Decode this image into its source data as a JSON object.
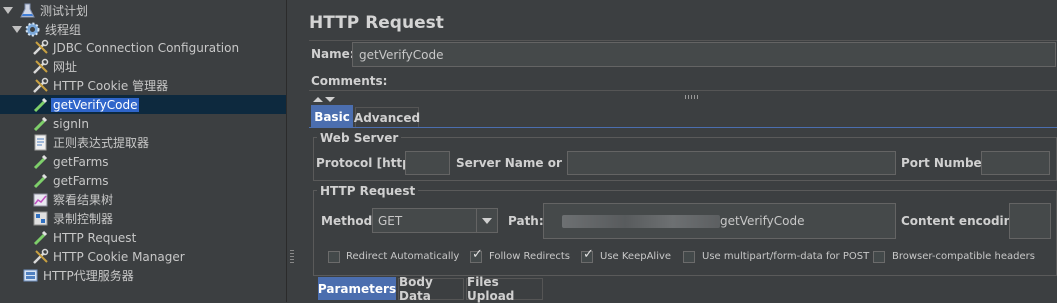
{
  "tree": {
    "items": [
      {
        "label": "测试计划",
        "icon": "flask-icon"
      },
      {
        "label": "线程组",
        "icon": "gear-icon"
      },
      {
        "label": "JDBC Connection Configuration",
        "icon": "wrench-icon"
      },
      {
        "label": "网址",
        "icon": "wrench-icon"
      },
      {
        "label": "HTTP Cookie 管理器",
        "icon": "wrench-icon"
      },
      {
        "label": "getVerifyCode",
        "icon": "pipette-icon"
      },
      {
        "label": "signIn",
        "icon": "pipette-icon"
      },
      {
        "label": "正则表达式提取器",
        "icon": "document-icon"
      },
      {
        "label": "getFarms",
        "icon": "pipette-icon"
      },
      {
        "label": "getFarms",
        "icon": "pipette-icon"
      },
      {
        "label": "察看结果树",
        "icon": "chart-icon"
      },
      {
        "label": "录制控制器",
        "icon": "controller-icon"
      },
      {
        "label": "HTTP Request",
        "icon": "pipette-icon"
      },
      {
        "label": "HTTP Cookie Manager",
        "icon": "wrench-icon"
      },
      {
        "label": "HTTP代理服务器",
        "icon": "server-icon"
      }
    ],
    "selected_index": 5
  },
  "panel": {
    "title": "HTTP Request",
    "name_label": "Name:",
    "name_value": "getVerifyCode",
    "comments_label": "Comments:",
    "tabs": [
      "Basic",
      "Advanced"
    ],
    "active_tab": "Basic",
    "web_server": {
      "legend": "Web Server",
      "protocol_label": "Protocol [http]:",
      "protocol_value": "",
      "server_label": "Server Name or IP:",
      "server_value": "",
      "port_label": "Port Number:",
      "port_value": ""
    },
    "http_request": {
      "legend": "HTTP Request",
      "method_label": "Method:",
      "method_value": "GET",
      "path_label": "Path:",
      "path_value": "getVerifyCode",
      "encoding_label": "Content encoding:",
      "encoding_value": ""
    },
    "options": [
      {
        "label": "Redirect Automatically",
        "checked": false
      },
      {
        "label": "Follow Redirects",
        "checked": true
      },
      {
        "label": "Use KeepAlive",
        "checked": true
      },
      {
        "label": "Use multipart/form-data for POST",
        "checked": false
      },
      {
        "label": "Browser-compatible headers",
        "checked": false
      }
    ],
    "bottom_tabs": [
      "Parameters",
      "Body Data",
      "Files Upload"
    ],
    "active_bottom_tab": "Parameters"
  },
  "colors": {
    "background": "#3c3f41",
    "selection": "#2f65ca",
    "active_tab": "#4b6eaf"
  }
}
